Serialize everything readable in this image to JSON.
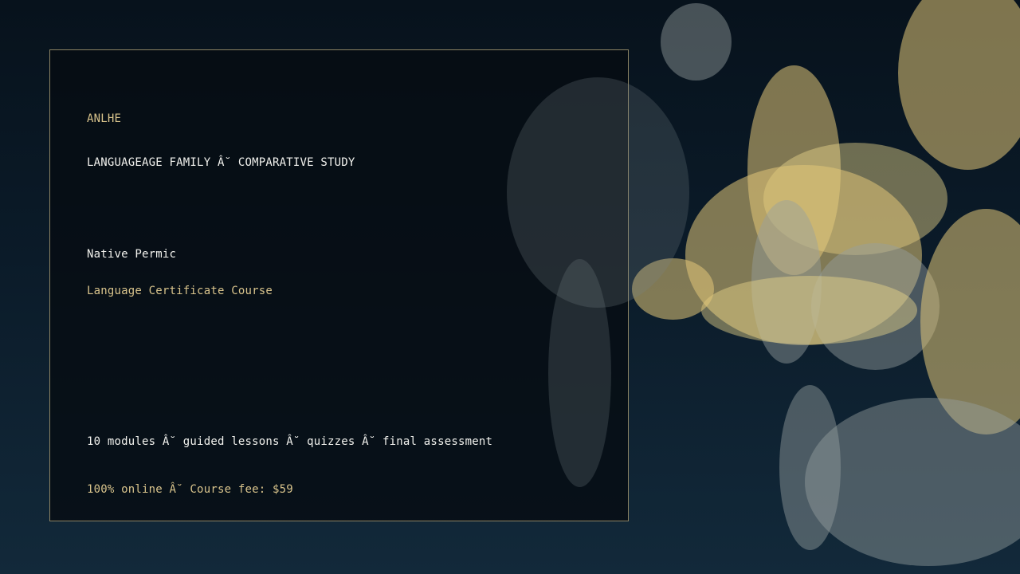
{
  "brand": "ANLHE",
  "subtitle": "LANGUAGEAGE FAMILY Â˘ COMPARATIVE STUDY",
  "course_name": "Native Permic",
  "course_type": "Language Certificate Course",
  "features": "10 modules Â˘ guided lessons Â˘ quizzes Â˘ final assessment",
  "pricing": "100% online Â˘ Course fee: $59",
  "colors": {
    "accent_gold": "#d9c48c",
    "text_white": "#f2f2ee",
    "border": "#8c8464",
    "background_top": "#07121c",
    "background_bottom": "#12293a"
  }
}
